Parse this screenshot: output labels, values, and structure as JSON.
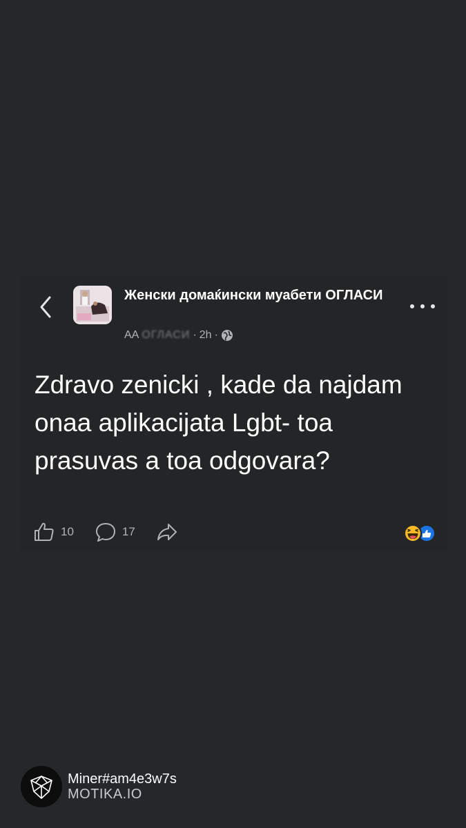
{
  "post": {
    "group_name": "Женски домаќински муабети ОГЛАСИ",
    "author": "AA",
    "author_blurred": "ОГЛАСИ",
    "time": "2h",
    "text": "Zdravo zenicki , kade da najdam onaa aplikacijata Lgbt- toa prasuvas a toa odgovara?",
    "likes_count": "10",
    "comments_count": "17",
    "reaction_icons": [
      "laughing-face-icon",
      "like-thumb-icon"
    ]
  },
  "watermark": {
    "handle": "Miner#am4e3w7s",
    "site": "MOTIKA.IO"
  },
  "colors": {
    "background": "#25272b",
    "card": "#242526",
    "text_primary": "#ffffff",
    "text_secondary": "#b0b3b8",
    "like_blue": "#1b74e4",
    "haha_yellow": "#f7b928"
  }
}
